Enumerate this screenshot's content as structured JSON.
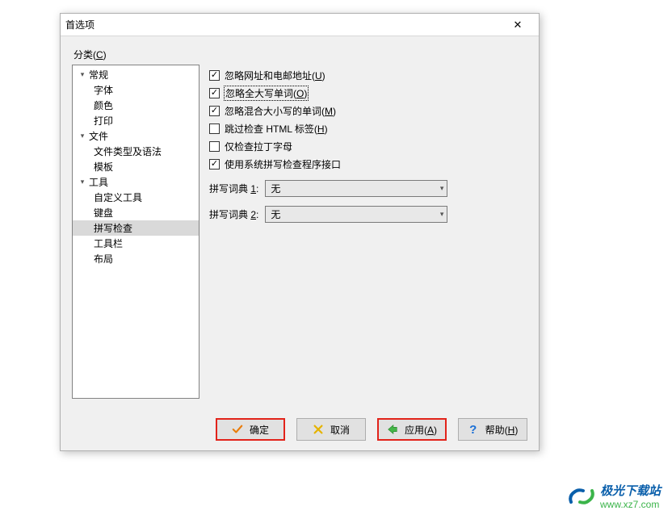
{
  "dialog": {
    "title": "首选项"
  },
  "sidebar": {
    "label_html": "分类(<u>C</u>)",
    "items": [
      {
        "label": "常规",
        "level": 0,
        "expandable": true
      },
      {
        "label": "字体",
        "level": 1,
        "expandable": false
      },
      {
        "label": "颜色",
        "level": 1,
        "expandable": false
      },
      {
        "label": "打印",
        "level": 1,
        "expandable": false
      },
      {
        "label": "文件",
        "level": 0,
        "expandable": true
      },
      {
        "label": "文件类型及语法",
        "level": 1,
        "expandable": false
      },
      {
        "label": "模板",
        "level": 1,
        "expandable": false
      },
      {
        "label": "工具",
        "level": 0,
        "expandable": true
      },
      {
        "label": "自定义工具",
        "level": 1,
        "expandable": false
      },
      {
        "label": "键盘",
        "level": 1,
        "expandable": false
      },
      {
        "label": "拼写检查",
        "level": 1,
        "expandable": false,
        "selected": true
      },
      {
        "label": "工具栏",
        "level": 1,
        "expandable": false
      },
      {
        "label": "布局",
        "level": 1,
        "expandable": false
      }
    ]
  },
  "panel": {
    "checks": [
      {
        "label_html": "忽略网址和电邮地址(<u>U</u>)",
        "checked": true,
        "focused": false
      },
      {
        "label_html": "忽略全大写单词(<u>O</u>)",
        "checked": true,
        "focused": true
      },
      {
        "label_html": "忽略混合大小写的单词(<u>M</u>)",
        "checked": true,
        "focused": false
      },
      {
        "label_html": "跳过检查 HTML 标签(<u>H</u>)",
        "checked": false,
        "focused": false
      },
      {
        "label_html": "仅检查拉丁字母",
        "checked": false,
        "focused": false
      },
      {
        "label_html": "使用系统拼写检查程序接口",
        "checked": true,
        "focused": false
      }
    ],
    "selects": [
      {
        "label_html": "拼写词典 <u>1</u>:",
        "value": "无"
      },
      {
        "label_html": "拼写词典 <u>2</u>:",
        "value": "无"
      }
    ]
  },
  "buttons": {
    "ok": "确定",
    "cancel": "取消",
    "apply_html": "应用(<u>A</u>)",
    "help_html": "帮助(<u>H</u>)"
  },
  "watermark": {
    "line1": "极光下载站",
    "line2": "www.xz7.com"
  }
}
